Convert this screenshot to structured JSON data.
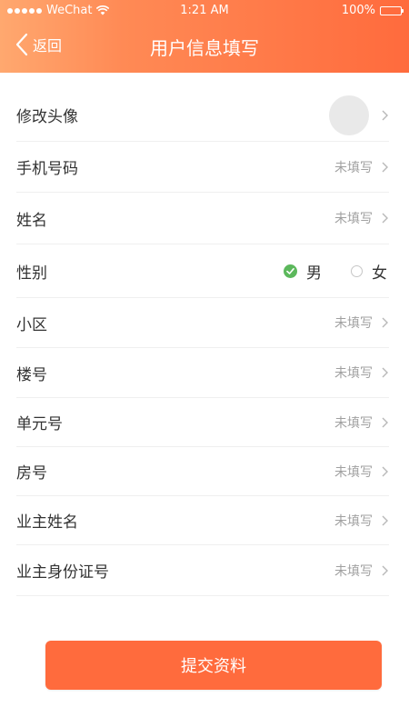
{
  "status_bar": {
    "carrier": "WeChat",
    "time": "1:21 AM",
    "battery": "100%",
    "battery_level": 1.0
  },
  "header": {
    "back_label": "返回",
    "title": "用户信息填写",
    "gradient": [
      "#ffa86f",
      "#ff6b3d"
    ]
  },
  "rows": [
    {
      "key": "avatar",
      "label": "修改头像",
      "value": ""
    },
    {
      "key": "phone",
      "label": "手机号码",
      "value": "未填写"
    },
    {
      "key": "name",
      "label": "姓名",
      "value": "未填写"
    },
    {
      "key": "gender",
      "label": "性别",
      "options": [
        "男",
        "女"
      ],
      "selected": "男"
    },
    {
      "key": "community",
      "label": "小区",
      "value": "未填写"
    },
    {
      "key": "building",
      "label": "楼号",
      "value": "未填写"
    },
    {
      "key": "unit",
      "label": "单元号",
      "value": "未填写"
    },
    {
      "key": "room",
      "label": "房号",
      "value": "未填写"
    },
    {
      "key": "owner_name",
      "label": "业主姓名",
      "value": "未填写"
    },
    {
      "key": "owner_id",
      "label": "业主身份证号",
      "value": "未填写"
    }
  ],
  "submit_label": "提交资料",
  "colors": {
    "accent": "#ff6b3d",
    "check": "#5cb85c",
    "placeholder_text": "#a0a0a0"
  }
}
